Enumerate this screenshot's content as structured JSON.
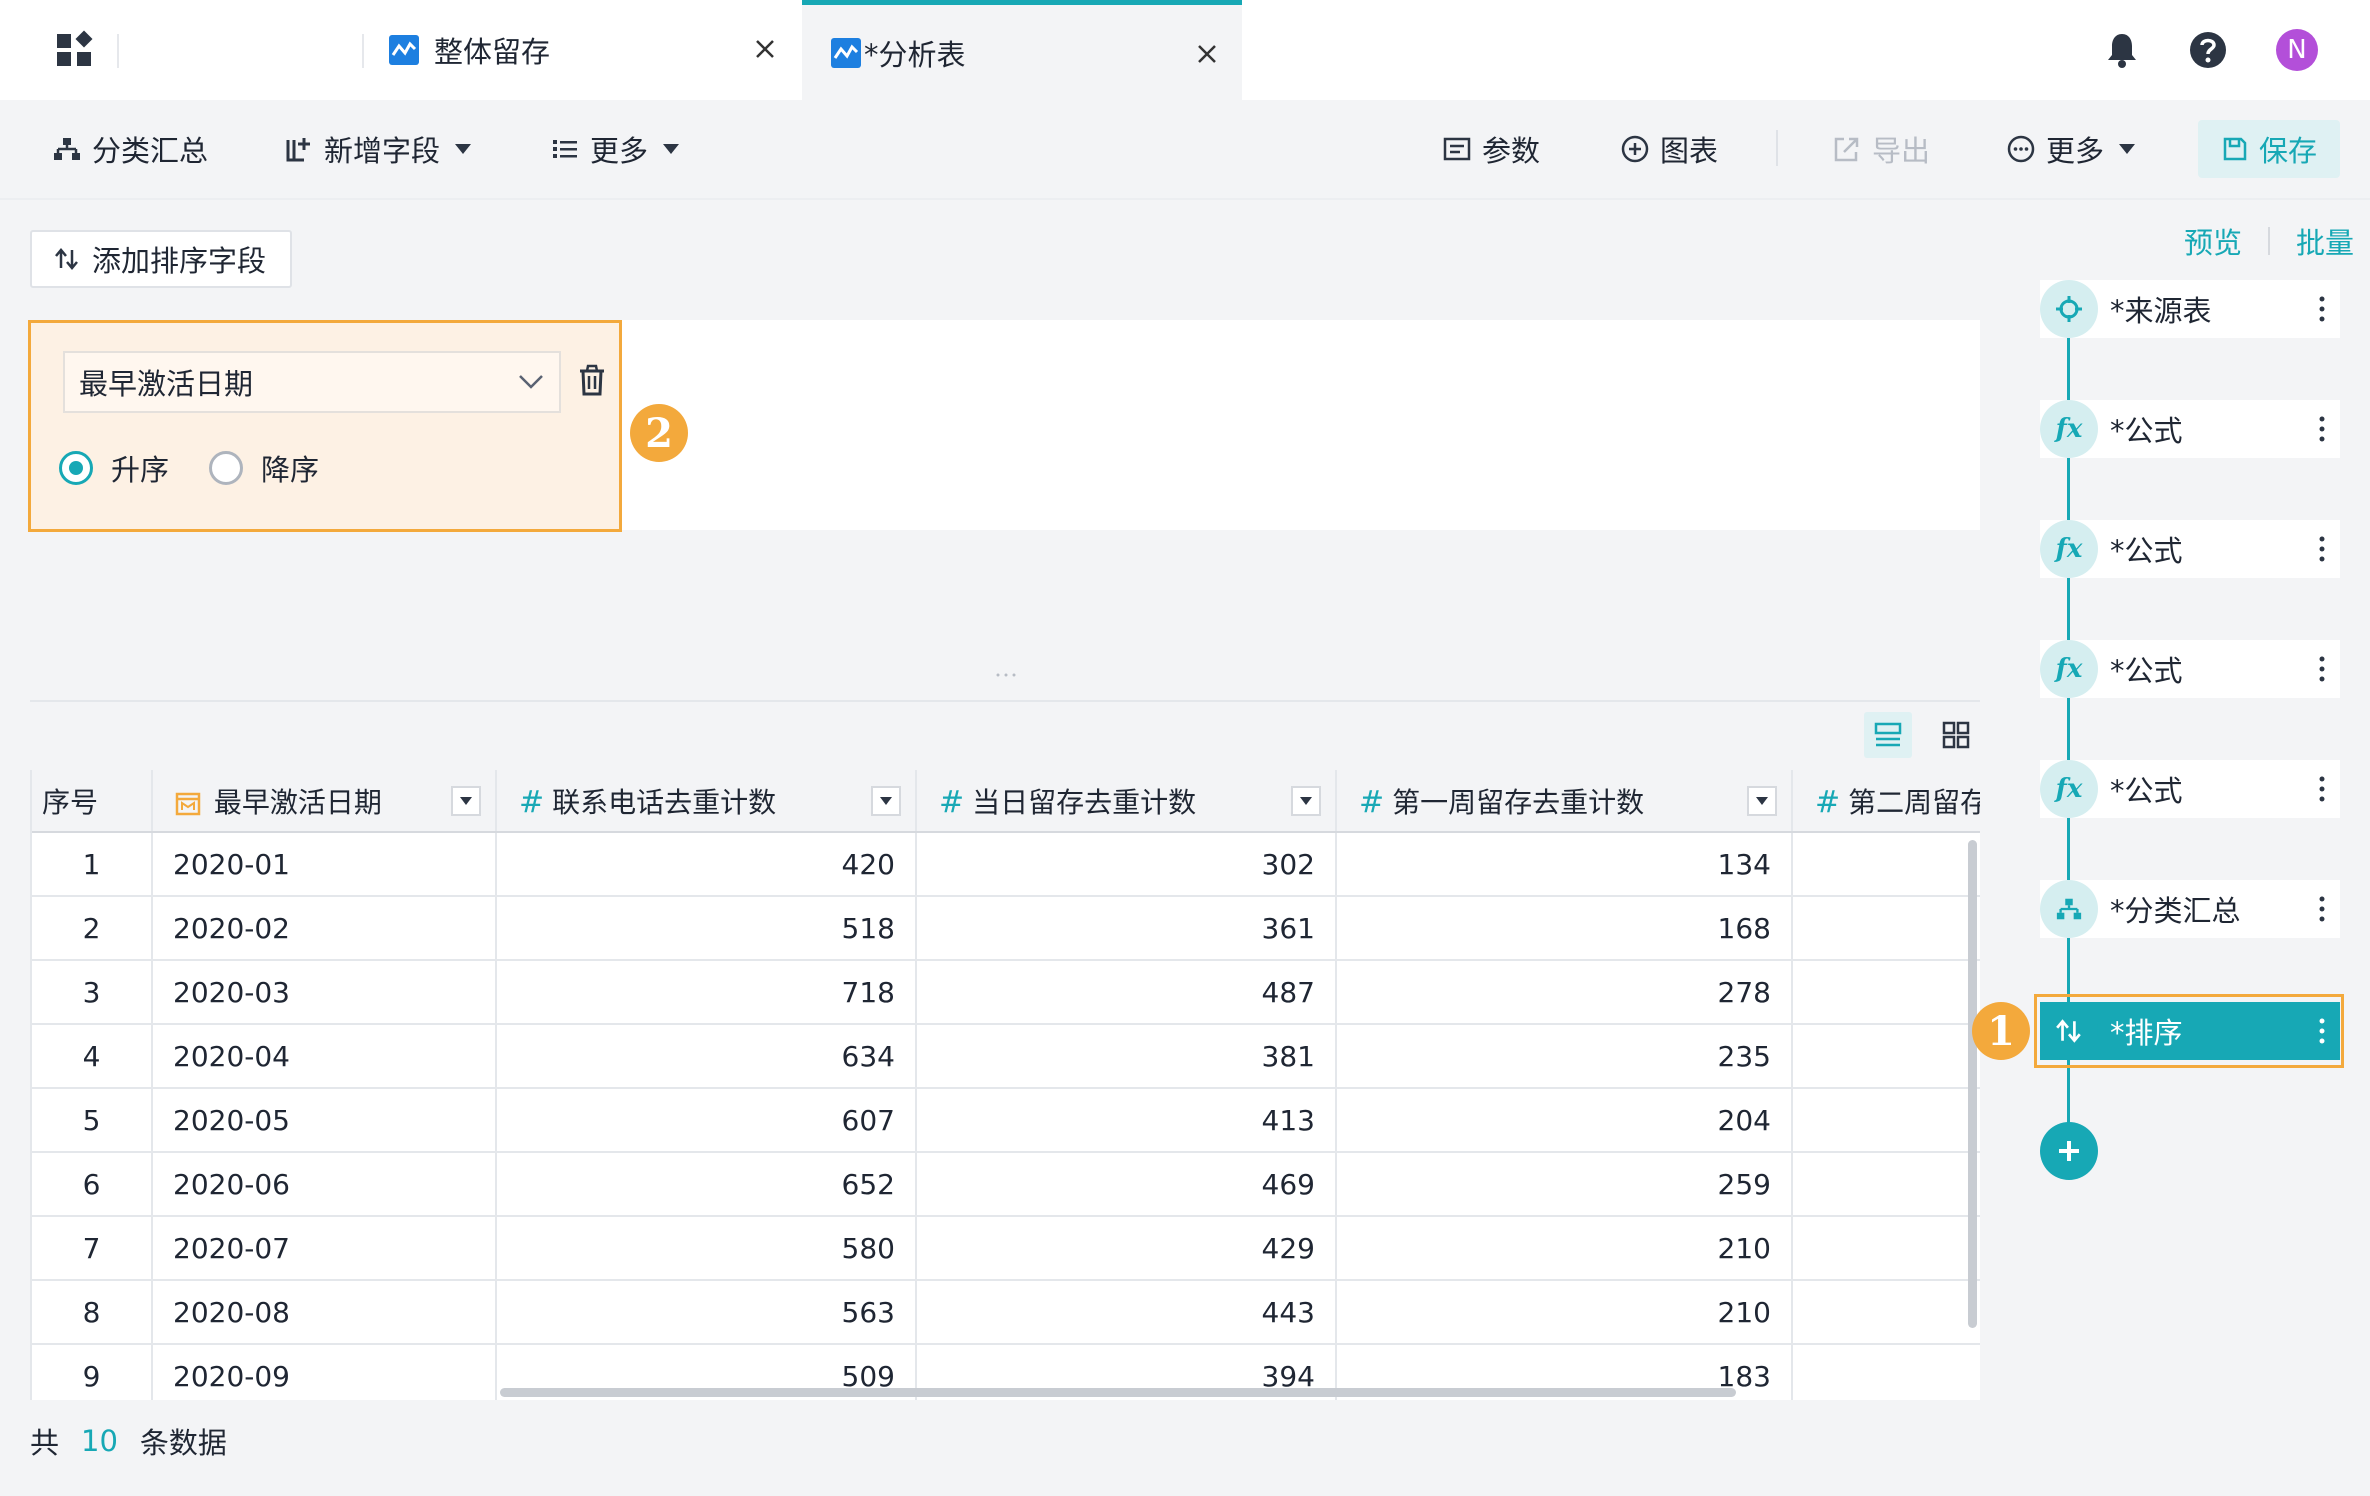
{
  "tabs": {
    "tab1_label": "整体留存",
    "tab2_label": "*分析表"
  },
  "toolbar": {
    "group_summary": "分类汇总",
    "add_field": "新增字段",
    "more_left": "更多",
    "params": "参数",
    "chart": "图表",
    "export": "导出",
    "more_right": "更多",
    "save": "保存"
  },
  "user": {
    "avatar_initial": "N"
  },
  "sort": {
    "add_sort_label": "添加排序字段",
    "selected_field": "最早激活日期",
    "asc_label": "升序",
    "desc_label": "降序",
    "order": "asc"
  },
  "badges": {
    "first": "1",
    "second": "2"
  },
  "table": {
    "columns": [
      {
        "label": "序号",
        "type": "index"
      },
      {
        "label": "最早激活日期",
        "type": "date"
      },
      {
        "label": "联系电话去重计数",
        "type": "number"
      },
      {
        "label": "当日留存去重计数",
        "type": "number"
      },
      {
        "label": "第一周留存去重计数",
        "type": "number"
      },
      {
        "label": "第二周留存",
        "type": "number"
      }
    ],
    "rows": [
      [
        "1",
        "2020-01",
        "420",
        "302",
        "134",
        ""
      ],
      [
        "2",
        "2020-02",
        "518",
        "361",
        "168",
        ""
      ],
      [
        "3",
        "2020-03",
        "718",
        "487",
        "278",
        ""
      ],
      [
        "4",
        "2020-04",
        "634",
        "381",
        "235",
        ""
      ],
      [
        "5",
        "2020-05",
        "607",
        "413",
        "204",
        ""
      ],
      [
        "6",
        "2020-06",
        "652",
        "469",
        "259",
        ""
      ],
      [
        "7",
        "2020-07",
        "580",
        "429",
        "210",
        ""
      ],
      [
        "8",
        "2020-08",
        "563",
        "443",
        "210",
        ""
      ],
      [
        "9",
        "2020-09",
        "509",
        "394",
        "183",
        ""
      ]
    ]
  },
  "footer": {
    "prefix": "共",
    "count": "10",
    "suffix": "条数据"
  },
  "side": {
    "preview": "预览",
    "batch": "批量",
    "nodes": [
      {
        "label": "*来源表",
        "icon": "crosshair-icon"
      },
      {
        "label": "*公式",
        "icon": "fx-icon"
      },
      {
        "label": "*公式",
        "icon": "fx-icon"
      },
      {
        "label": "*公式",
        "icon": "fx-icon"
      },
      {
        "label": "*公式",
        "icon": "fx-icon"
      },
      {
        "label": "*分类汇总",
        "icon": "hierarchy-icon"
      },
      {
        "label": "*排序",
        "icon": "sort-icon"
      }
    ],
    "fx_symbol": "fx"
  },
  "colors": {
    "accent": "#17a8b5",
    "highlight": "#f3a93c",
    "avatar": "#b34fd9"
  }
}
